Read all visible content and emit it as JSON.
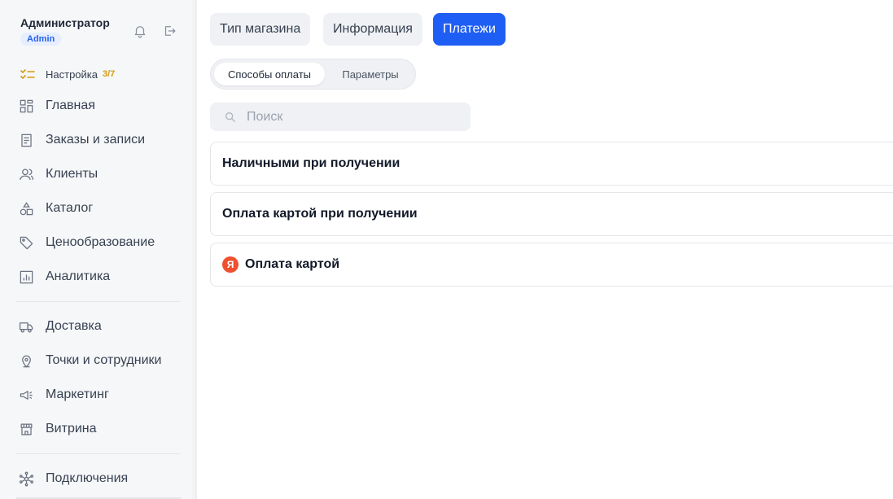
{
  "user": {
    "name": "Администратор",
    "role": "Admin"
  },
  "setup": {
    "label": "Настройка",
    "count": "3/7"
  },
  "nav": [
    {
      "label": "Главная",
      "icon": "grid-icon"
    },
    {
      "label": "Заказы и записи",
      "icon": "orders-icon"
    },
    {
      "label": "Клиенты",
      "icon": "users-icon"
    },
    {
      "label": "Каталог",
      "icon": "shapes-icon"
    },
    {
      "label": "Ценообразование",
      "icon": "tag-icon"
    },
    {
      "label": "Аналитика",
      "icon": "chart-icon"
    },
    {
      "label": "Доставка",
      "icon": "truck-icon"
    },
    {
      "label": "Точки и сотрудники",
      "icon": "location-pin-icon"
    },
    {
      "label": "Маркетинг",
      "icon": "megaphone-icon"
    },
    {
      "label": "Витрина",
      "icon": "storefront-icon"
    },
    {
      "label": "Подключения",
      "icon": "network-icon"
    }
  ],
  "tabs": [
    {
      "label": "Тип магазина",
      "active": false
    },
    {
      "label": "Информация",
      "active": false
    },
    {
      "label": "Платежи",
      "active": true
    }
  ],
  "subtabs": [
    {
      "label": "Способы оплаты",
      "active": true
    },
    {
      "label": "Параметры",
      "active": false
    }
  ],
  "search": {
    "placeholder": "Поиск",
    "value": ""
  },
  "methods": [
    {
      "label": "Наличными при получении"
    },
    {
      "label": "Оплата картой при получении"
    },
    {
      "label": "Оплата картой",
      "logo": "Я"
    }
  ],
  "colors": {
    "accent": "#1f5ef5",
    "setup_count": "#d59a12",
    "yandex": "#f0502f"
  }
}
